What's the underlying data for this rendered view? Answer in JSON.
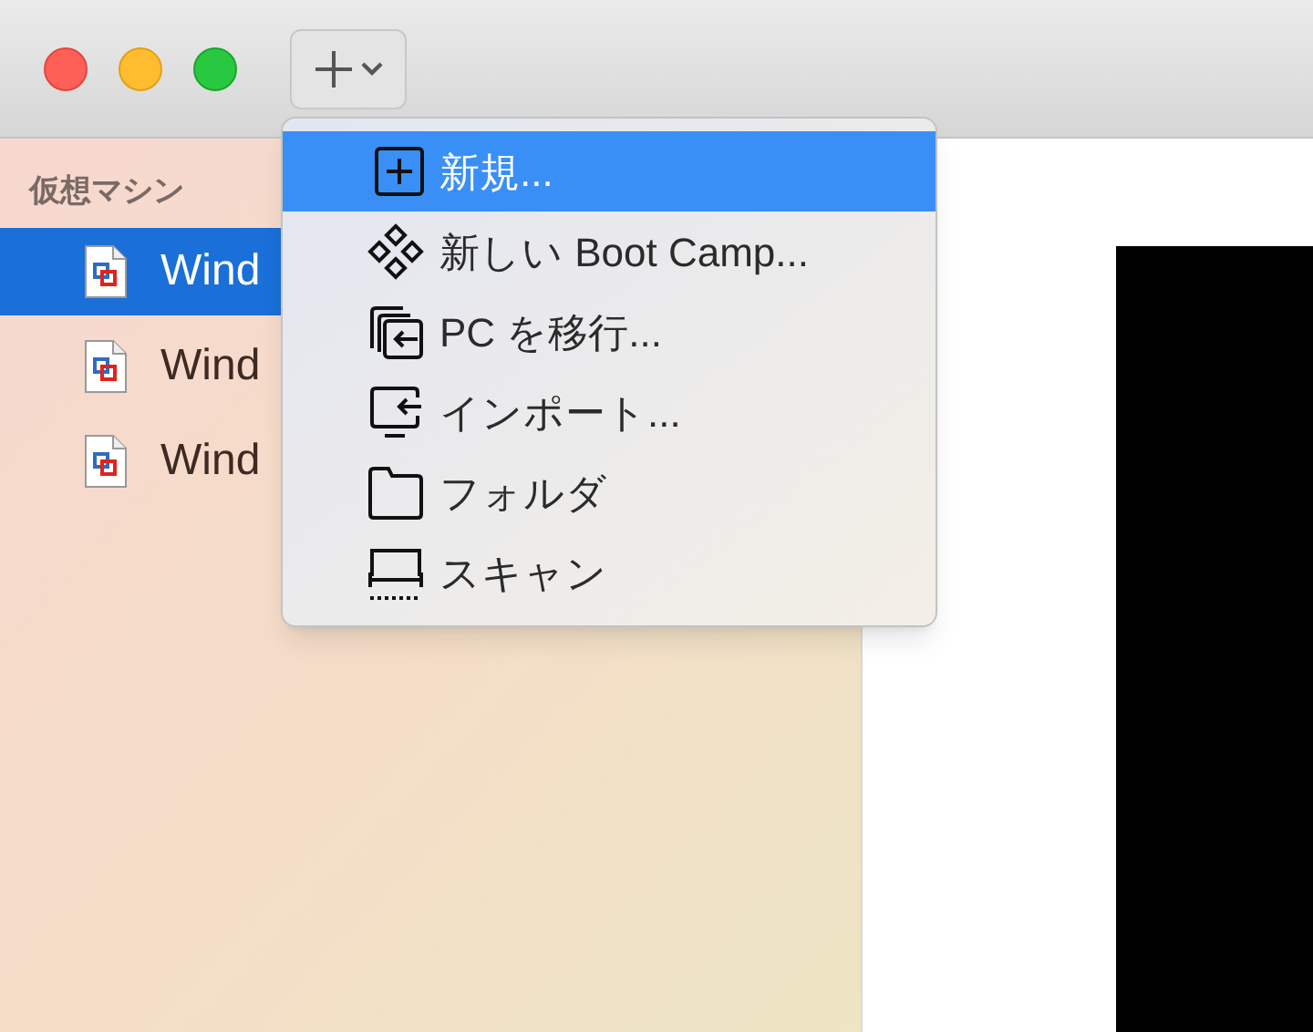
{
  "toolbar": {
    "add_button": {
      "expanded": true
    }
  },
  "sidebar": {
    "header": "仮想マシン",
    "items": [
      {
        "label": "Wind",
        "selected": true
      },
      {
        "label": "Wind",
        "selected": false
      },
      {
        "label": "Wind",
        "selected": false
      }
    ]
  },
  "menu": {
    "items": [
      {
        "label": "新規...",
        "selected": true
      },
      {
        "label": "新しい Boot Camp...",
        "selected": false
      },
      {
        "label": "PC を移行...",
        "selected": false
      },
      {
        "label": "インポート...",
        "selected": false
      },
      {
        "label": "フォルダ",
        "selected": false
      },
      {
        "label": "スキャン",
        "selected": false
      }
    ]
  }
}
